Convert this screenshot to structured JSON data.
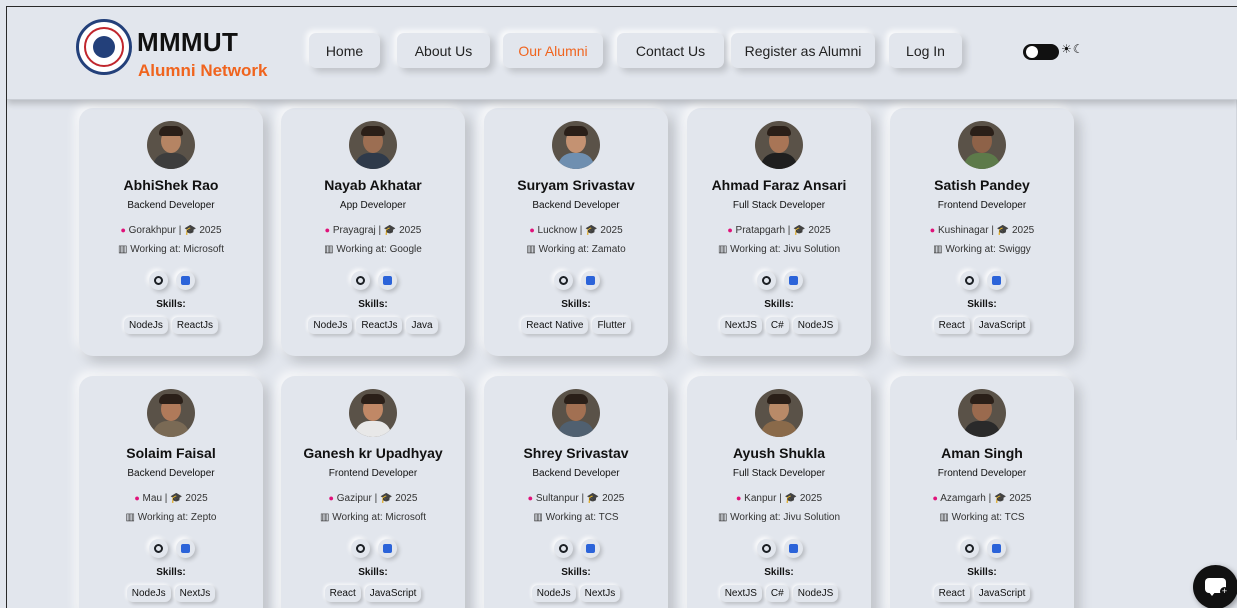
{
  "brand": {
    "title": "MMMUT",
    "subtitle": "Alumni Network"
  },
  "nav": [
    {
      "label": "Home",
      "active": false
    },
    {
      "label": "About Us",
      "active": false
    },
    {
      "label": "Our Alumni",
      "active": true
    },
    {
      "label": "Contact Us",
      "active": false
    },
    {
      "label": "Register as Alumni",
      "active": false
    },
    {
      "label": "Log In",
      "active": false
    }
  ],
  "theme_toggle": {
    "icons": "☀☾",
    "mode": "light"
  },
  "skills_label": "Skills:",
  "alumni": [
    {
      "name": "AbhiShek Rao",
      "role": "Backend Developer",
      "location": "Gorakhpur",
      "year": "2025",
      "work": "Working at: Microsoft",
      "skills": [
        "NodeJs",
        "ReactJs"
      ]
    },
    {
      "name": "Nayab Akhatar",
      "role": "App Developer",
      "location": "Prayagraj",
      "year": "2025",
      "work": "Working at: Google",
      "skills": [
        "NodeJs",
        "ReactJs",
        "Java"
      ]
    },
    {
      "name": "Suryam Srivastav",
      "role": "Backend Developer",
      "location": "Lucknow",
      "year": "2025",
      "work": "Working at: Zamato",
      "skills": [
        "React Native",
        "Flutter"
      ]
    },
    {
      "name": "Ahmad Faraz Ansari",
      "role": "Full Stack Developer",
      "location": "Pratapgarh",
      "year": "2025",
      "work": "Working at: Jivu Solution",
      "skills": [
        "NextJS",
        "C#",
        "NodeJS"
      ]
    },
    {
      "name": "Satish Pandey",
      "role": "Frontend Developer",
      "location": "Kushinagar",
      "year": "2025",
      "work": "Working at: Swiggy",
      "skills": [
        "React",
        "JavaScript"
      ]
    },
    {
      "name": "Solaim Faisal",
      "role": "Backend Developer",
      "location": "Mau",
      "year": "2025",
      "work": "Working at: Zepto",
      "skills": [
        "NodeJs",
        "NextJs"
      ]
    },
    {
      "name": "Ganesh kr Upadhyay",
      "role": "Frontend Developer",
      "location": "Gazipur",
      "year": "2025",
      "work": "Working at: Microsoft",
      "skills": [
        "React",
        "JavaScript"
      ]
    },
    {
      "name": "Shrey Srivastav",
      "role": "Backend Developer",
      "location": "Sultanpur",
      "year": "2025",
      "work": "Working at: TCS",
      "skills": [
        "NodeJs",
        "NextJs"
      ]
    },
    {
      "name": "Ayush Shukla",
      "role": "Full Stack Developer",
      "location": "Kanpur",
      "year": "2025",
      "work": "Working at: Jivu Solution",
      "skills": [
        "NextJS",
        "C#",
        "NodeJS"
      ]
    },
    {
      "name": "Aman Singh",
      "role": "Frontend Developer",
      "location": "Azamgarh",
      "year": "2025",
      "work": "Working at: TCS",
      "skills": [
        "React",
        "JavaScript"
      ]
    }
  ],
  "colors": {
    "accent": "#f0641e",
    "background": "#e2e6ed",
    "pin": "#e0127a",
    "linkedin": "#2b63d9"
  }
}
